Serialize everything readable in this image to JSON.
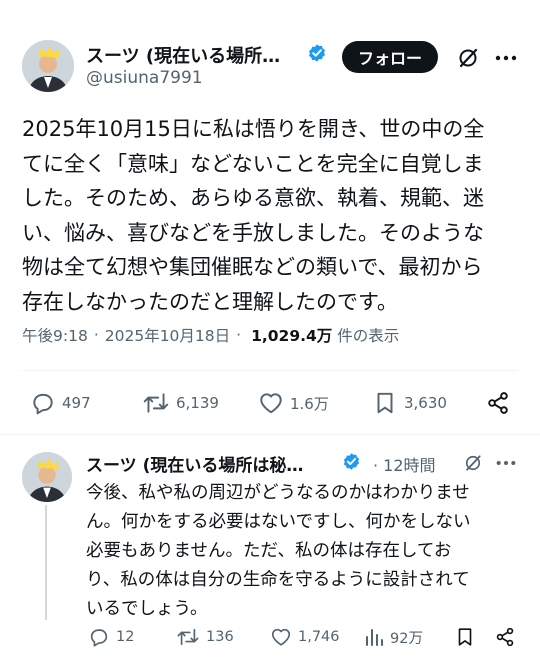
{
  "tweet": {
    "author_name": "スーツ (現在いる場所…",
    "author_handle": "@usiuna7991",
    "follow_label": "フォロー",
    "text": "2025年10月15日に私は悟りを開き、世の中の全\nてに全く「意味」などないことを完全に自覚しま\nした。そのため、あらゆる意欲、執着、規範、迷\nい、悩み、喜びなどを手放しました。そのような\n物は全て幻想や集団催眠などの類いで、最初から\n存在しなかったのだと理解したのです。",
    "time": "午後9:18",
    "date": "2025年10月18日",
    "views_count": "1,029.4万",
    "views_label": "件の表示",
    "replies": "497",
    "retweets": "6,139",
    "likes": "1.6万",
    "bookmarks": "3,630"
  },
  "reply": {
    "author_name": "スーツ (現在いる場所は秘…",
    "time": "· 12時間",
    "text": "今後、私や私の周辺がどうなるのかはわかりませ\nん。何かをする必要はないですし、何かをしない\n必要もありません。ただ、私の体は存在してお\nり、私の体は自分の生命を守るように設計されて\nいるでしょう。",
    "replies": "12",
    "retweets": "136",
    "likes": "1,746",
    "views": "92万"
  },
  "colors": {
    "text": "#0f1419",
    "muted": "#536471",
    "verified": "#1d9bf0",
    "follow_bg": "#0f1419"
  }
}
